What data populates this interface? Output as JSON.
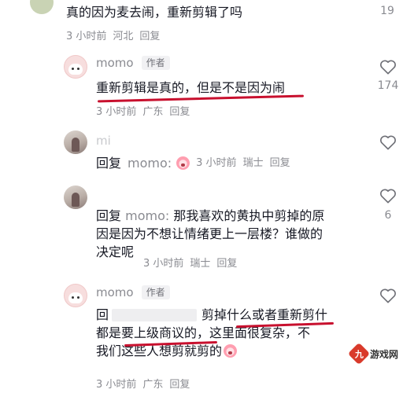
{
  "comments": [
    {
      "text": "真的因为麦去闹，重新剪辑了吗",
      "time": "3 小时前",
      "location": "河北",
      "reply": "回复",
      "likes": "19"
    },
    {
      "name": "momo",
      "badge": "作者",
      "text": "重新剪辑是真的，但是不是因为闹",
      "time": "3 小时前",
      "location": "广东",
      "reply": "回复",
      "likes": "174"
    },
    {
      "name": "mi",
      "reply_prefix": "回复",
      "reply_to": "momo:",
      "time": "3 小时前",
      "location": "瑞士",
      "reply": "回复"
    },
    {
      "reply_prefix": "回复",
      "reply_to": "momo:",
      "text": "那我喜欢的黄执中剪掉的原因是因为不想让情绪更上一层楼？谁做的决定呢",
      "line1": "那我喜欢的黄执中剪掉的原",
      "line2": "因是因为不想让情绪更上一层楼？谁做的",
      "line3": "决定呢",
      "time": "3 小时前",
      "location": "瑞士",
      "reply": "回复",
      "likes": "6"
    },
    {
      "name": "momo",
      "badge": "作者",
      "line1_prefix": "回",
      "line1_main": "剪掉什么或者重新剪什",
      "line2": "都是要上级商议的，这里面很复杂，不",
      "line3": "我们这些人想剪就剪的",
      "time": "3 小时前",
      "location": "广东",
      "reply": "回复"
    }
  ],
  "watermark": {
    "logo": "九",
    "text": "游戏网"
  },
  "colors": {
    "underline": "#c8102e",
    "muted": "#8a8b91",
    "text": "#161823"
  }
}
